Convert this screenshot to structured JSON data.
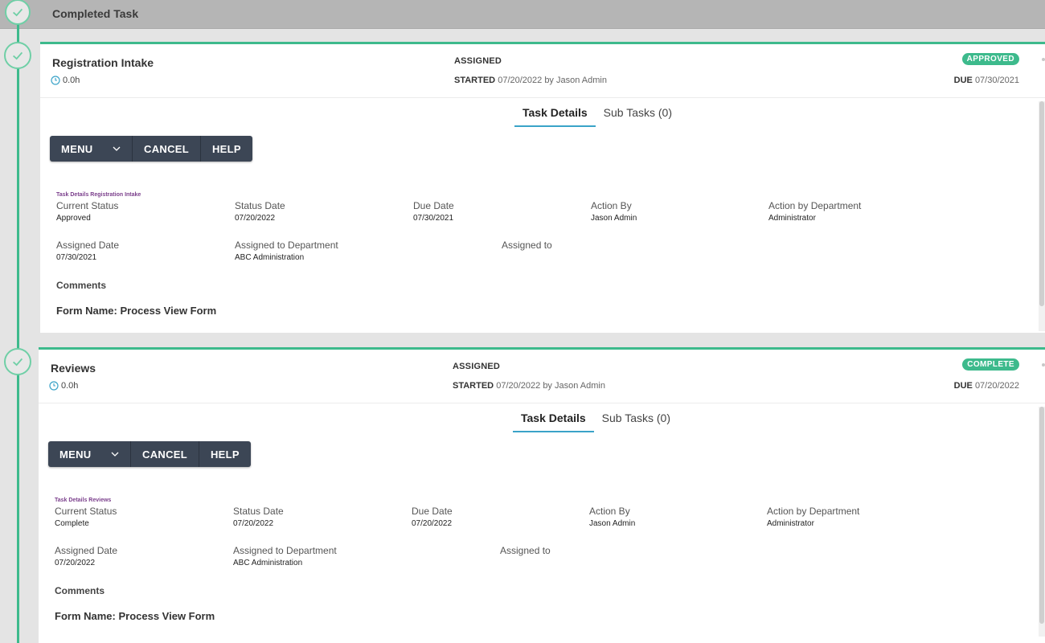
{
  "header": {
    "title": "Completed Task"
  },
  "tasks": [
    {
      "name": "Registration Intake",
      "duration": "0.0h",
      "assigned_label": "ASSIGNED",
      "started_label": "STARTED",
      "started_value": "07/20/2022 by Jason Admin",
      "status_badge": "APPROVED",
      "due_label": "DUE",
      "due_value": "07/30/2021",
      "tabs": [
        "Task Details",
        "Sub Tasks (0)"
      ],
      "toolbar": {
        "menu": "MENU",
        "cancel": "CANCEL",
        "help": "HELP"
      },
      "details_caption": "Task Details Registration Intake",
      "fields": {
        "current_status": {
          "label": "Current Status",
          "value": "Approved"
        },
        "status_date": {
          "label": "Status Date",
          "value": "07/20/2022"
        },
        "due_date": {
          "label": "Due Date",
          "value": "07/30/2021"
        },
        "action_by": {
          "label": "Action By",
          "value": "Jason Admin"
        },
        "action_by_department": {
          "label": "Action by Department",
          "value": "Administrator"
        },
        "assigned_date": {
          "label": "Assigned Date",
          "value": "07/30/2021"
        },
        "assigned_to_department": {
          "label": "Assigned to Department",
          "value": "ABC Administration"
        },
        "assigned_to": {
          "label": "Assigned to",
          "value": ""
        }
      },
      "comments_label": "Comments",
      "form_name": "Form Name: Process View Form"
    },
    {
      "name": "Reviews",
      "duration": "0.0h",
      "assigned_label": "ASSIGNED",
      "started_label": "STARTED",
      "started_value": "07/20/2022 by Jason Admin",
      "status_badge": "COMPLETE",
      "due_label": "DUE",
      "due_value": "07/20/2022",
      "tabs": [
        "Task Details",
        "Sub Tasks (0)"
      ],
      "toolbar": {
        "menu": "MENU",
        "cancel": "CANCEL",
        "help": "HELP"
      },
      "details_caption": "Task Details Reviews",
      "fields": {
        "current_status": {
          "label": "Current Status",
          "value": "Complete"
        },
        "status_date": {
          "label": "Status Date",
          "value": "07/20/2022"
        },
        "due_date": {
          "label": "Due Date",
          "value": "07/20/2022"
        },
        "action_by": {
          "label": "Action By",
          "value": "Jason Admin"
        },
        "action_by_department": {
          "label": "Action by Department",
          "value": "Administrator"
        },
        "assigned_date": {
          "label": "Assigned Date",
          "value": "07/20/2022"
        },
        "assigned_to_department": {
          "label": "Assigned to Department",
          "value": "ABC Administration"
        },
        "assigned_to": {
          "label": "Assigned to",
          "value": ""
        }
      },
      "comments_label": "Comments",
      "form_name": "Form Name: Process View Form"
    }
  ],
  "colors": {
    "accent_green": "#3dba8c",
    "toolbar_bg": "#3c4655",
    "tab_underline": "#3aa3c8",
    "header_bg": "#b5b5b5",
    "caption_purple": "#7b3f8c"
  },
  "icons": {
    "timeline": "check-circle-icon",
    "duration": "clock-icon",
    "menu_dropdown": "chevron-down-icon"
  }
}
